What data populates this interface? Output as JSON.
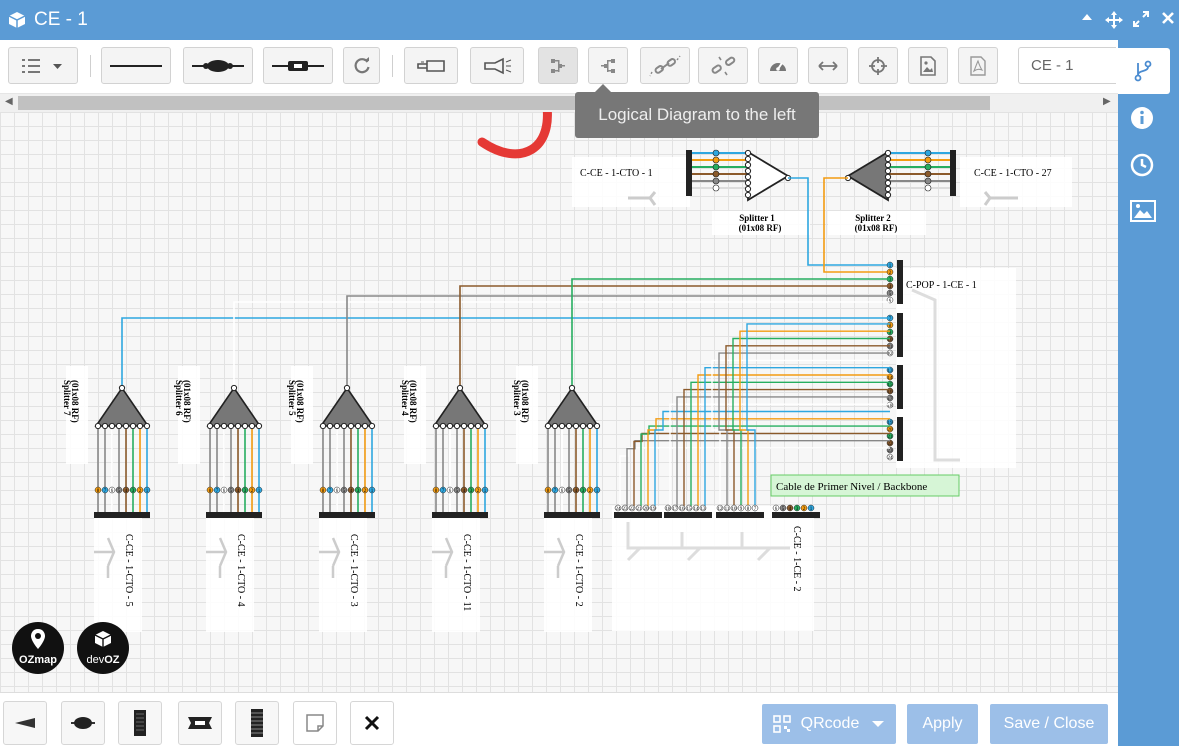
{
  "window": {
    "title": "CE - 1"
  },
  "toolbar": {
    "ce_value": "CE - 1"
  },
  "tooltip": {
    "text": "Logical Diagram to the left"
  },
  "diagram": {
    "splitter_top_1": {
      "name": "Splitter 1",
      "ratio": "(01x08 RF)"
    },
    "splitter_top_2": {
      "name": "Splitter 2",
      "ratio": "(01x08 RF)"
    },
    "cto_left": "C-CE - 1-CTO - 1",
    "cto_right": "C-CE - 1-CTO - 27",
    "pop": "C-POP - 1-CE - 1",
    "backbone": "Cable de Primer Nivel / Backbone",
    "splitters_bottom": [
      {
        "name": "Splitter 7",
        "ratio": "(01x08 RF)",
        "cto": "C-CE - 1-CTO - 5"
      },
      {
        "name": "Splitter 6",
        "ratio": "(01x08 RF)",
        "cto": "C-CE - 1-CTO - 4"
      },
      {
        "name": "Splitter 5",
        "ratio": "(01x08 RF)",
        "cto": "C-CE - 1-CTO - 3"
      },
      {
        "name": "Splitter 4",
        "ratio": "(01x08 RF)",
        "cto": "C-CE - 1-CTO - 11"
      },
      {
        "name": "Splitter 3",
        "ratio": "(01x08 RF)",
        "cto": "C-CE - 1-CTO - 2"
      }
    ],
    "cable_bottom": "C-CE - 1-CE - 2",
    "pop_ports": [
      "1",
      "2",
      "3",
      "4",
      "5",
      "6",
      "7",
      "8",
      "9",
      "10",
      "11",
      "12",
      "13",
      "14",
      "15",
      "16",
      "17",
      "18",
      "19",
      "20",
      "21",
      "22",
      "23",
      "24"
    ],
    "splitter_ports": [
      "8",
      "7",
      "6",
      "5",
      "4",
      "3",
      "2",
      "1"
    ],
    "fiber_colors": [
      "#2ea7e0",
      "#f39c12",
      "#27ae60",
      "#8b5a2b",
      "#888888",
      "#ffffff"
    ]
  },
  "badges": {
    "ozmap": "OZmap",
    "devoz_prefix": "dev",
    "devoz_suffix": "OZ"
  },
  "bottom": {
    "qrcode": "QRcode",
    "apply": "Apply",
    "save_close": "Save / Close"
  }
}
